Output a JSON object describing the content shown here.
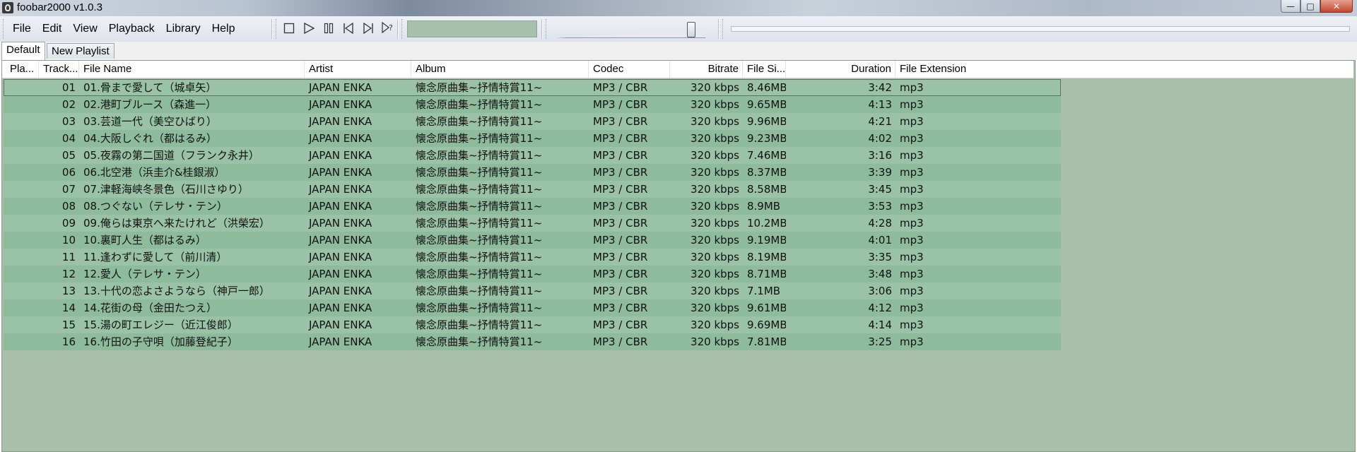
{
  "window": {
    "title": "foobar2000 v1.0.3"
  },
  "menu": [
    "File",
    "Edit",
    "View",
    "Playback",
    "Library",
    "Help"
  ],
  "controls": {
    "stop": "stop-icon",
    "play": "play-icon",
    "pause": "pause-icon",
    "previous": "previous-icon",
    "next": "next-icon",
    "random": "random-icon"
  },
  "volume_level": 0.9,
  "tabs": [
    "Default",
    "New Playlist"
  ],
  "columns": [
    "Pla...",
    "Track...",
    "File Name",
    "Artist",
    "Album",
    "Codec",
    "Bitrate",
    "File Si...",
    "Duration",
    "File Extension"
  ],
  "rows": [
    {
      "track": "01",
      "file": "01.骨まで愛して（城卓矢）",
      "artist": "JAPAN ENKA",
      "album": "懐念原曲集~抒情特賞11~",
      "codec": "MP3 / CBR",
      "bitrate": "320 kbps",
      "size": "8.46MB",
      "duration": "3:42",
      "ext": "mp3"
    },
    {
      "track": "02",
      "file": "02.港町ブルース（森進一）",
      "artist": "JAPAN ENKA",
      "album": "懐念原曲集~抒情特賞11~",
      "codec": "MP3 / CBR",
      "bitrate": "320 kbps",
      "size": "9.65MB",
      "duration": "4:13",
      "ext": "mp3"
    },
    {
      "track": "03",
      "file": "03.芸道一代（美空ひばり）",
      "artist": "JAPAN ENKA",
      "album": "懐念原曲集~抒情特賞11~",
      "codec": "MP3 / CBR",
      "bitrate": "320 kbps",
      "size": "9.96MB",
      "duration": "4:21",
      "ext": "mp3"
    },
    {
      "track": "04",
      "file": "04.大阪しぐれ（都はるみ）",
      "artist": "JAPAN ENKA",
      "album": "懐念原曲集~抒情特賞11~",
      "codec": "MP3 / CBR",
      "bitrate": "320 kbps",
      "size": "9.23MB",
      "duration": "4:02",
      "ext": "mp3"
    },
    {
      "track": "05",
      "file": "05.夜霧の第二国道（フランク永井）",
      "artist": "JAPAN ENKA",
      "album": "懐念原曲集~抒情特賞11~",
      "codec": "MP3 / CBR",
      "bitrate": "320 kbps",
      "size": "7.46MB",
      "duration": "3:16",
      "ext": "mp3"
    },
    {
      "track": "06",
      "file": "06.北空港（浜圭介&桂銀淑）",
      "artist": "JAPAN ENKA",
      "album": "懐念原曲集~抒情特賞11~",
      "codec": "MP3 / CBR",
      "bitrate": "320 kbps",
      "size": "8.37MB",
      "duration": "3:39",
      "ext": "mp3"
    },
    {
      "track": "07",
      "file": "07.津軽海峡冬景色（石川さゆり）",
      "artist": "JAPAN ENKA",
      "album": "懐念原曲集~抒情特賞11~",
      "codec": "MP3 / CBR",
      "bitrate": "320 kbps",
      "size": "8.58MB",
      "duration": "3:45",
      "ext": "mp3"
    },
    {
      "track": "08",
      "file": "08.つぐない（テレサ・テン）",
      "artist": "JAPAN ENKA",
      "album": "懐念原曲集~抒情特賞11~",
      "codec": "MP3 / CBR",
      "bitrate": "320 kbps",
      "size": "8.9MB",
      "duration": "3:53",
      "ext": "mp3"
    },
    {
      "track": "09",
      "file": "09.俺らは東京へ来たけれど（洪榮宏）",
      "artist": "JAPAN ENKA",
      "album": "懐念原曲集~抒情特賞11~",
      "codec": "MP3 / CBR",
      "bitrate": "320 kbps",
      "size": "10.2MB",
      "duration": "4:28",
      "ext": "mp3"
    },
    {
      "track": "10",
      "file": "10.裏町人生（都はるみ）",
      "artist": "JAPAN ENKA",
      "album": "懐念原曲集~抒情特賞11~",
      "codec": "MP3 / CBR",
      "bitrate": "320 kbps",
      "size": "9.19MB",
      "duration": "4:01",
      "ext": "mp3"
    },
    {
      "track": "11",
      "file": "11.逢わずに愛して（前川清）",
      "artist": "JAPAN ENKA",
      "album": "懐念原曲集~抒情特賞11~",
      "codec": "MP3 / CBR",
      "bitrate": "320 kbps",
      "size": "8.19MB",
      "duration": "3:35",
      "ext": "mp3"
    },
    {
      "track": "12",
      "file": "12.愛人（テレサ・テン）",
      "artist": "JAPAN ENKA",
      "album": "懐念原曲集~抒情特賞11~",
      "codec": "MP3 / CBR",
      "bitrate": "320 kbps",
      "size": "8.71MB",
      "duration": "3:48",
      "ext": "mp3"
    },
    {
      "track": "13",
      "file": "13.十代の恋よさようなら（神戸一郎）",
      "artist": "JAPAN ENKA",
      "album": "懐念原曲集~抒情特賞11~",
      "codec": "MP3 / CBR",
      "bitrate": "320 kbps",
      "size": "7.1MB",
      "duration": "3:06",
      "ext": "mp3"
    },
    {
      "track": "14",
      "file": "14.花街の母（金田たつえ）",
      "artist": "JAPAN ENKA",
      "album": "懐念原曲集~抒情特賞11~",
      "codec": "MP3 / CBR",
      "bitrate": "320 kbps",
      "size": "9.61MB",
      "duration": "4:12",
      "ext": "mp3"
    },
    {
      "track": "15",
      "file": "15.湯の町エレジー（近江俊郎）",
      "artist": "JAPAN ENKA",
      "album": "懐念原曲集~抒情特賞11~",
      "codec": "MP3 / CBR",
      "bitrate": "320 kbps",
      "size": "9.69MB",
      "duration": "4:14",
      "ext": "mp3"
    },
    {
      "track": "16",
      "file": "16.竹田の子守唄（加藤登紀子）",
      "artist": "JAPAN ENKA",
      "album": "懐念原曲集~抒情特賞11~",
      "codec": "MP3 / CBR",
      "bitrate": "320 kbps",
      "size": "7.81MB",
      "duration": "3:25",
      "ext": "mp3"
    }
  ],
  "colors": {
    "playlist_bg": "#a8c0a9",
    "row_odd": "#99c2a6",
    "row_even": "#8dbb9c",
    "visualizer": "#a6c2ac"
  }
}
